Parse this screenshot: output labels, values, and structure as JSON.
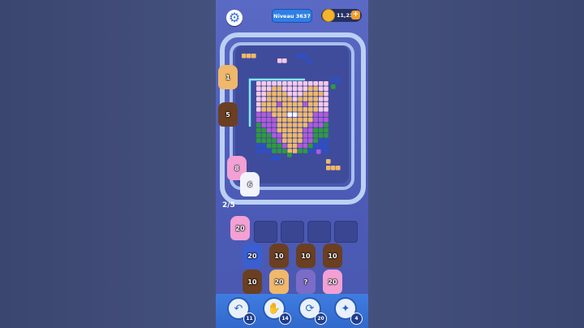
{
  "header": {
    "level_label": "Niveau 3637",
    "coins_label": "11,23k",
    "plus_label": "+",
    "settings_glyph": "⚙"
  },
  "queue": {
    "progress_label": "2/5"
  },
  "track_pigs": [
    {
      "count": "1",
      "color": "#f0b86a"
    },
    {
      "count": "5",
      "color": "#6b3f22"
    },
    {
      "count": "8",
      "color": "#f3a0d4"
    },
    {
      "count": "6",
      "color": "#f2f4fb"
    }
  ],
  "waiting_pig": {
    "count": "20",
    "color": "#f3a0d4"
  },
  "grid_pigs": [
    {
      "count": "20",
      "color": "#3b5fd1"
    },
    {
      "count": "10",
      "color": "#6b3f22"
    },
    {
      "count": "10",
      "color": "#6b3f22"
    },
    {
      "count": "10",
      "color": "#6b3f22"
    },
    {
      "count": "10",
      "color": "#6b3f22"
    },
    {
      "count": "20",
      "color": "#f0b86a"
    },
    {
      "count": "?",
      "color": "#7b6cc8"
    },
    {
      "count": "20",
      "color": "#f3a0d4"
    }
  ],
  "boosters": [
    {
      "name": "undo-booster",
      "glyph": "↶",
      "count": "11"
    },
    {
      "name": "hand-booster",
      "glyph": "✋",
      "count": "14"
    },
    {
      "name": "shuffle-booster",
      "glyph": "⟳",
      "count": "20"
    },
    {
      "name": "magnet-booster",
      "glyph": "✦",
      "count": "4"
    }
  ],
  "colors": {
    "pink": "#f3a0d4",
    "light_pink": "#f7c9e6",
    "tan": "#f0b86a",
    "purple": "#b25ad8",
    "green": "#2e9b3e",
    "blue": "#2d4fc8",
    "white": "#f4f4fb",
    "brown": "#6b3f22"
  }
}
